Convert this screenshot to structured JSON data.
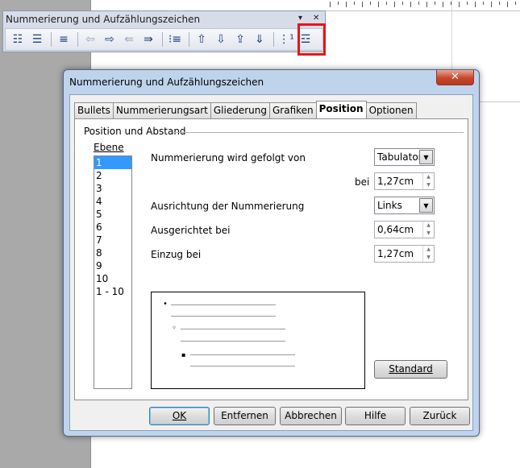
{
  "toolbar": {
    "title": "Nummerierung und Aufzählungszeichen",
    "menu_glyph": "▾",
    "close_glyph": "✕",
    "buttons": [
      {
        "name": "bullets-on-off-icon",
        "glyph": "☷",
        "dim": false
      },
      {
        "name": "numbering-on-off-icon",
        "glyph": "☰",
        "dim": false
      },
      {
        "name": "sep"
      },
      {
        "name": "no-list-icon",
        "glyph": "≡",
        "dim": false
      },
      {
        "name": "sep"
      },
      {
        "name": "demote-arrow-left-icon",
        "glyph": "⇦",
        "dim": true
      },
      {
        "name": "promote-arrow-right-icon",
        "glyph": "⇨",
        "dim": false
      },
      {
        "name": "demote-with-subpoints-icon",
        "glyph": "⇚",
        "dim": true
      },
      {
        "name": "promote-with-subpoints-icon",
        "glyph": "⇛",
        "dim": false
      },
      {
        "name": "sep"
      },
      {
        "name": "insert-unnumbered-entry-icon",
        "glyph": "⁝≡",
        "dim": false
      },
      {
        "name": "sep"
      },
      {
        "name": "move-up-icon",
        "glyph": "⇧",
        "dim": false
      },
      {
        "name": "move-down-icon",
        "glyph": "⇩",
        "dim": false
      },
      {
        "name": "move-up-with-subpoints-icon",
        "glyph": "⇪",
        "dim": false
      },
      {
        "name": "move-down-with-subpoints-icon",
        "glyph": "⇓",
        "dim": false
      },
      {
        "name": "sep"
      },
      {
        "name": "restart-numbering-icon",
        "glyph": "⋮¹",
        "dim": false
      },
      {
        "name": "bullets-and-numbering-icon",
        "glyph": "☲",
        "dim": false
      }
    ]
  },
  "dialog": {
    "title": "Nummerierung und Aufzählungszeichen",
    "close_glyph": "✕",
    "tabs": [
      {
        "label": "Bullets",
        "active": false
      },
      {
        "label": "Nummerierungsart",
        "active": false
      },
      {
        "label": "Gliederung",
        "active": false
      },
      {
        "label": "Grafiken",
        "active": false
      },
      {
        "label": "Position",
        "active": true
      },
      {
        "label": "Optionen",
        "active": false
      }
    ],
    "section": "Position und Abstand",
    "level_label": "Ebene",
    "levels": [
      "1",
      "2",
      "3",
      "4",
      "5",
      "6",
      "7",
      "8",
      "9",
      "10",
      "1 - 10"
    ],
    "selected_level": "1",
    "fields": {
      "followed_by_label": "Nummerierung wird gefolgt von",
      "followed_by_value": "Tabulator",
      "at_label": "bei",
      "at_value": "1,27cm",
      "alignment_label": "Ausrichtung der Nummerierung",
      "alignment_value": "Links",
      "aligned_at_label": "Ausgerichtet bei",
      "aligned_at_value": "0,64cm",
      "indent_label": "Einzug bei",
      "indent_value": "1,27cm"
    },
    "preview_bullets": [
      "•",
      "◦",
      "▪"
    ],
    "buttons": {
      "standard": "Standard",
      "ok": "OK",
      "remove": "Entfernen",
      "cancel": "Abbrechen",
      "help": "Hilfe",
      "back": "Zurück"
    }
  }
}
